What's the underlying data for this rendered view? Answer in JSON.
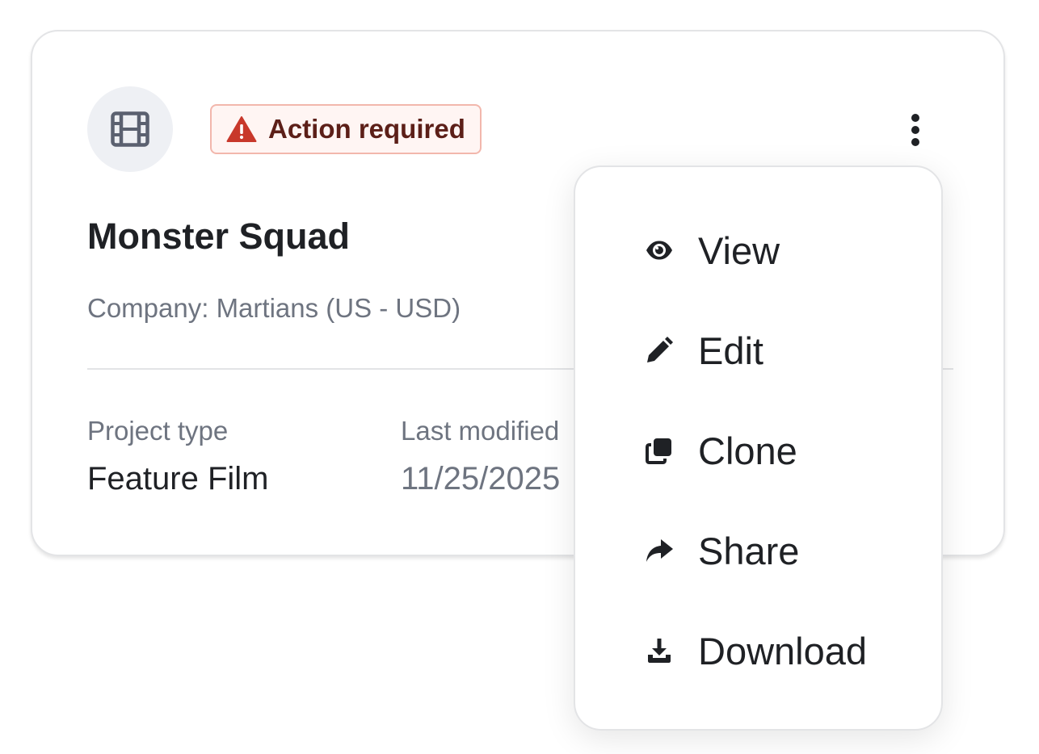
{
  "card": {
    "badge": {
      "label": "Action required",
      "icon": "warning-triangle-icon",
      "color": "#c8382b"
    },
    "title": "Monster Squad",
    "company": "Company: Martians (US - USD)",
    "meta": [
      {
        "label": "Project type",
        "value": "Feature Film"
      },
      {
        "label": "Last modified",
        "value": "11/25/2025"
      }
    ],
    "media_icon": "film-icon",
    "more_icon": "kebab-menu-icon"
  },
  "menu": {
    "items": [
      {
        "label": "View",
        "icon": "eye-icon"
      },
      {
        "label": "Edit",
        "icon": "pencil-icon"
      },
      {
        "label": "Clone",
        "icon": "clone-icon"
      },
      {
        "label": "Share",
        "icon": "share-icon"
      },
      {
        "label": "Download",
        "icon": "download-icon"
      }
    ]
  }
}
